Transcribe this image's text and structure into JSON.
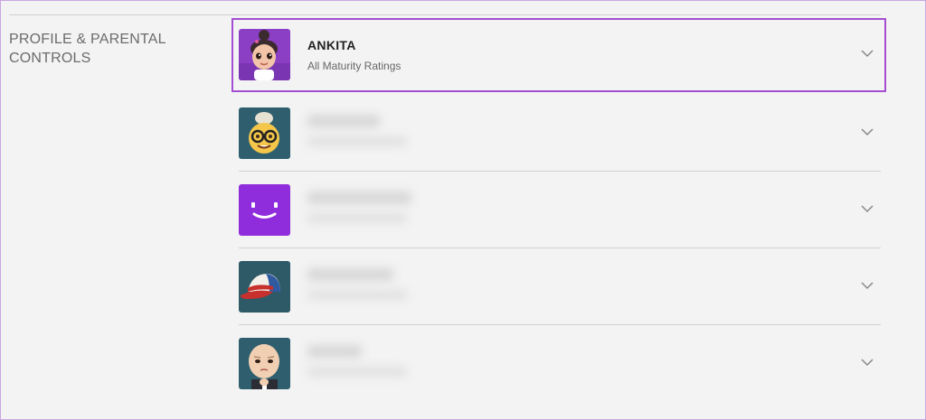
{
  "section": {
    "title": "PROFILE & PARENTAL CONTROLS"
  },
  "profiles": [
    {
      "name": "ANKITA",
      "subtitle": "All Maturity Ratings",
      "avatar": "kid-girl-avatar",
      "selected": true
    },
    {
      "name": "",
      "subtitle": "",
      "avatar": "glasses-emoji-avatar",
      "blurred": true
    },
    {
      "name": "",
      "subtitle": "",
      "avatar": "purple-smile-avatar",
      "blurred": true
    },
    {
      "name": "",
      "subtitle": "",
      "avatar": "trucker-cap-avatar",
      "blurred": true
    },
    {
      "name": "",
      "subtitle": "",
      "avatar": "boss-baby-avatar",
      "blurred": true
    }
  ],
  "colors": {
    "highlight_border": "#a54ed2",
    "background": "#f3f3f3"
  }
}
